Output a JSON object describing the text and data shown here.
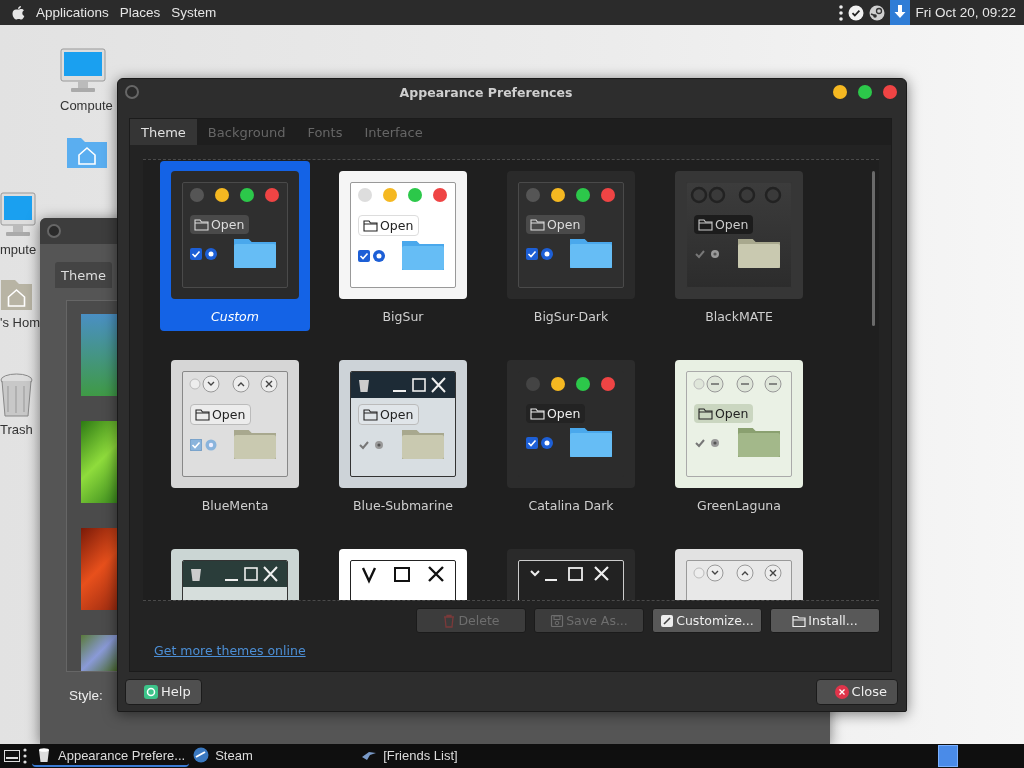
{
  "top_panel": {
    "menus": [
      "Applications",
      "Places",
      "System"
    ],
    "clock": "Fri Oct 20, 09:22"
  },
  "partial_icons": [
    {
      "label": "mpute",
      "kind": "computer"
    },
    {
      "label": "'s Hom",
      "kind": "home"
    },
    {
      "label": "Trash",
      "kind": "trash"
    }
  ],
  "desktop_icons": [
    {
      "label": "Compute",
      "kind": "computer"
    },
    {
      "kind": "home"
    }
  ],
  "back_window": {
    "tab": "Theme",
    "style_label": "Style:"
  },
  "window": {
    "title": "Appearance Preferences",
    "tabs": [
      {
        "label": "Theme",
        "selected": true
      },
      {
        "label": "Background",
        "selected": false
      },
      {
        "label": "Fonts",
        "selected": false
      },
      {
        "label": "Interface",
        "selected": false
      }
    ],
    "themes": [
      {
        "name": "Custom",
        "kind": "mac-dark",
        "button_label": "Open",
        "selected": true,
        "custom": true
      },
      {
        "name": "BigSur",
        "kind": "mac-light",
        "button_label": "Open",
        "selected": false,
        "custom": false
      },
      {
        "name": "BigSur-Dark",
        "kind": "mac-dark",
        "button_label": "Open",
        "selected": false,
        "custom": false
      },
      {
        "name": "BlackMATE",
        "kind": "blackmate",
        "button_label": "Open",
        "selected": false,
        "custom": false
      },
      {
        "name": "BlueMenta",
        "kind": "menta",
        "button_label": "Open",
        "selected": false,
        "custom": false
      },
      {
        "name": "Blue-Submarine",
        "kind": "submarine",
        "button_label": "Open",
        "selected": false,
        "custom": false
      },
      {
        "name": "Catalina Dark",
        "kind": "catalina",
        "button_label": "Open",
        "selected": false,
        "custom": false
      },
      {
        "name": "GreenLaguna",
        "kind": "laguna",
        "button_label": "Open",
        "selected": false,
        "custom": false
      },
      {
        "kind": "submarine-green",
        "selected": false
      },
      {
        "kind": "outline",
        "selected": false
      },
      {
        "kind": "outline-dark",
        "selected": false
      },
      {
        "kind": "menta-light",
        "selected": false
      }
    ],
    "actions": [
      {
        "label": "Delete",
        "kind": "delete",
        "disabled": true
      },
      {
        "label": "Save As...",
        "kind": "save",
        "disabled": true
      },
      {
        "label": "Customize...",
        "kind": "edit",
        "disabled": false
      },
      {
        "label": "Install...",
        "kind": "folder",
        "disabled": false
      }
    ],
    "link": "Get more themes online",
    "help": "Help",
    "close": "Close"
  },
  "taskbar": {
    "items": [
      {
        "label": "Appearance Prefere...",
        "kind": "bin",
        "selected": true
      },
      {
        "label": "Steam",
        "kind": "round",
        "selected": false
      },
      {
        "label": "[Friends List]",
        "kind": "bird",
        "selected": false
      }
    ]
  }
}
